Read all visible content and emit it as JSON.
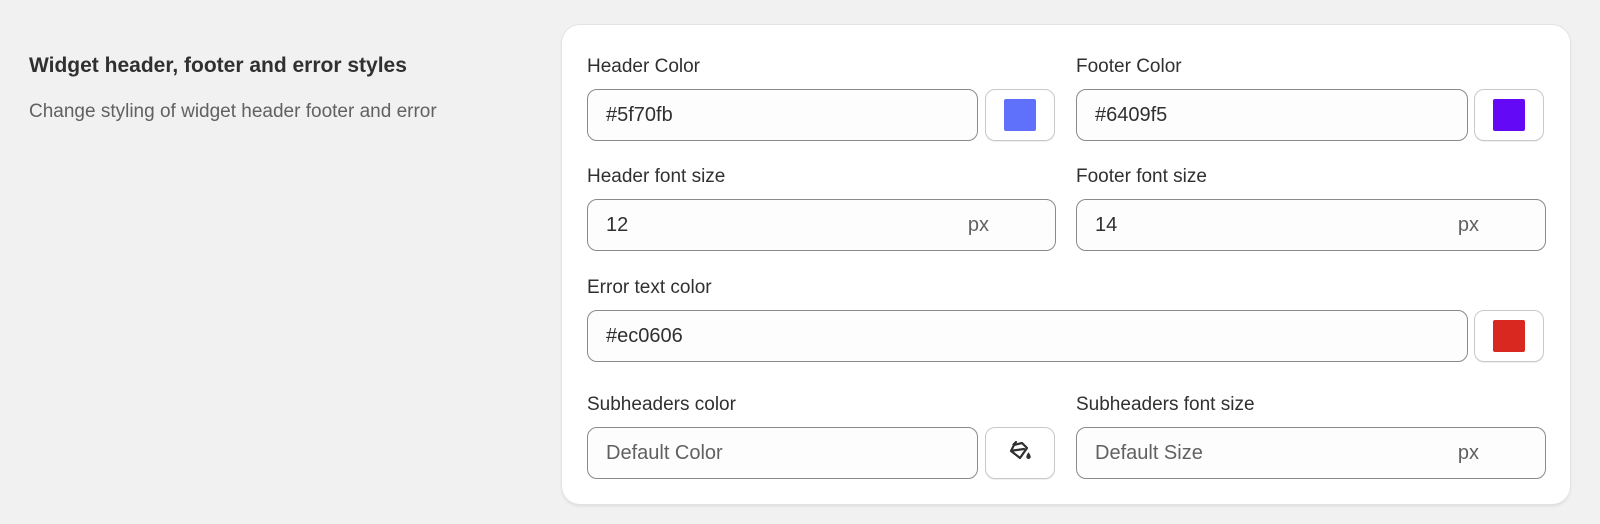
{
  "section": {
    "title": "Widget header, footer and error styles",
    "description": "Change styling of widget header footer and error"
  },
  "fields": {
    "header_color": {
      "label": "Header Color",
      "value": "#5f70fb",
      "swatch": "#5f70fb"
    },
    "footer_color": {
      "label": "Footer Color",
      "value": "#6409f5",
      "swatch": "#6409f5"
    },
    "header_font_size": {
      "label": "Header font size",
      "value": "12",
      "suffix": "px"
    },
    "footer_font_size": {
      "label": "Footer font size",
      "value": "14",
      "suffix": "px"
    },
    "error_text_color": {
      "label": "Error text color",
      "value": "#ec0606",
      "swatch": "#d9281f"
    },
    "subheaders_color": {
      "label": "Subheaders color",
      "placeholder": "Default Color",
      "icon": "paint-bucket-icon"
    },
    "subheaders_font_size": {
      "label": "Subheaders font size",
      "placeholder": "Default Size",
      "suffix": "px"
    }
  }
}
